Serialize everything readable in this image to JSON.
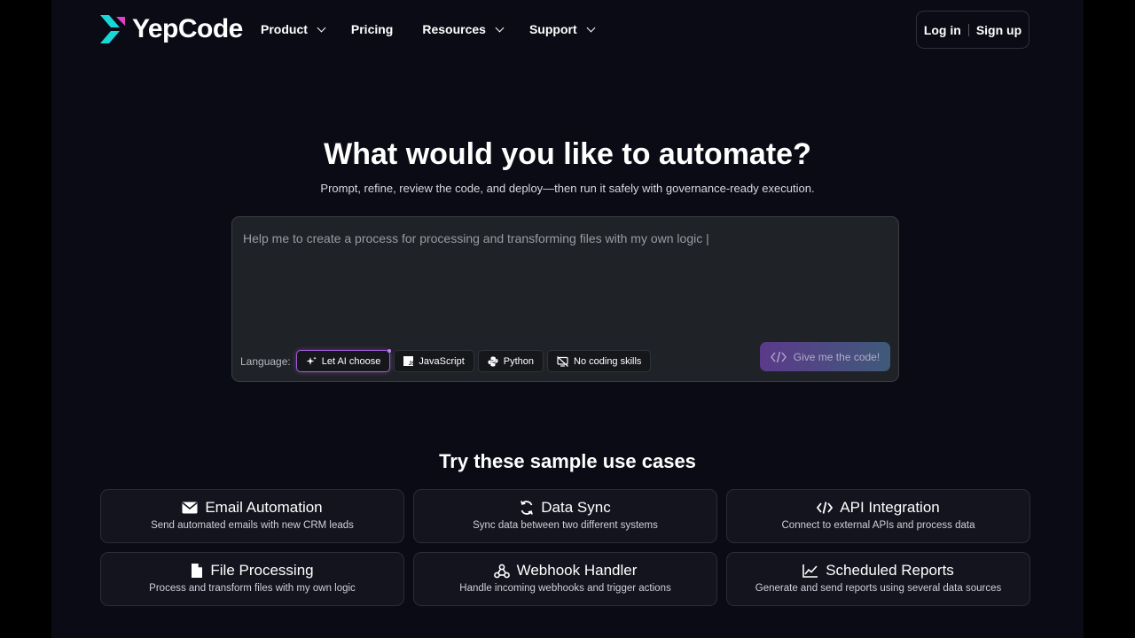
{
  "header": {
    "logo_text": "YepCode",
    "nav": [
      {
        "label": "Product",
        "has_dropdown": true
      },
      {
        "label": "Pricing",
        "has_dropdown": false
      },
      {
        "label": "Resources",
        "has_dropdown": true
      },
      {
        "label": "Support",
        "has_dropdown": true
      }
    ],
    "login_label": "Log in",
    "signup_label": "Sign up"
  },
  "hero": {
    "title": "What would you like to automate?",
    "subtitle": "Prompt, refine, review the code, and deploy—then run it safely with governance-ready execution."
  },
  "prompt": {
    "value": "Help me to create a process for processing and transforming files with my own logic |",
    "language_label": "Language:",
    "languages": [
      {
        "label": "Let AI choose",
        "icon": "sparkle-icon",
        "selected": true
      },
      {
        "label": "JavaScript",
        "icon": "javascript-icon",
        "selected": false
      },
      {
        "label": "Python",
        "icon": "python-icon",
        "selected": false
      },
      {
        "label": "No coding skills",
        "icon": "no-code-icon",
        "selected": false
      }
    ],
    "submit_label": "Give me the code!"
  },
  "use_cases": {
    "title": "Try these sample use cases",
    "items": [
      {
        "title": "Email Automation",
        "desc": "Send automated emails with new CRM leads",
        "icon": "mail-icon"
      },
      {
        "title": "Data Sync",
        "desc": "Sync data between two different systems",
        "icon": "sync-icon"
      },
      {
        "title": "API Integration",
        "desc": "Connect to external APIs and process data",
        "icon": "code-icon"
      },
      {
        "title": "File Processing",
        "desc": "Process and transform files with my own logic",
        "icon": "file-icon"
      },
      {
        "title": "Webhook Handler",
        "desc": "Handle incoming webhooks and trigger actions",
        "icon": "webhook-icon"
      },
      {
        "title": "Scheduled Reports",
        "desc": "Generate and send reports using several data sources",
        "icon": "chart-line-icon"
      }
    ]
  },
  "colors": {
    "background": "#0b0b16",
    "accent_cyan": "#1ad6d6",
    "accent_purple": "#a05bd4"
  }
}
